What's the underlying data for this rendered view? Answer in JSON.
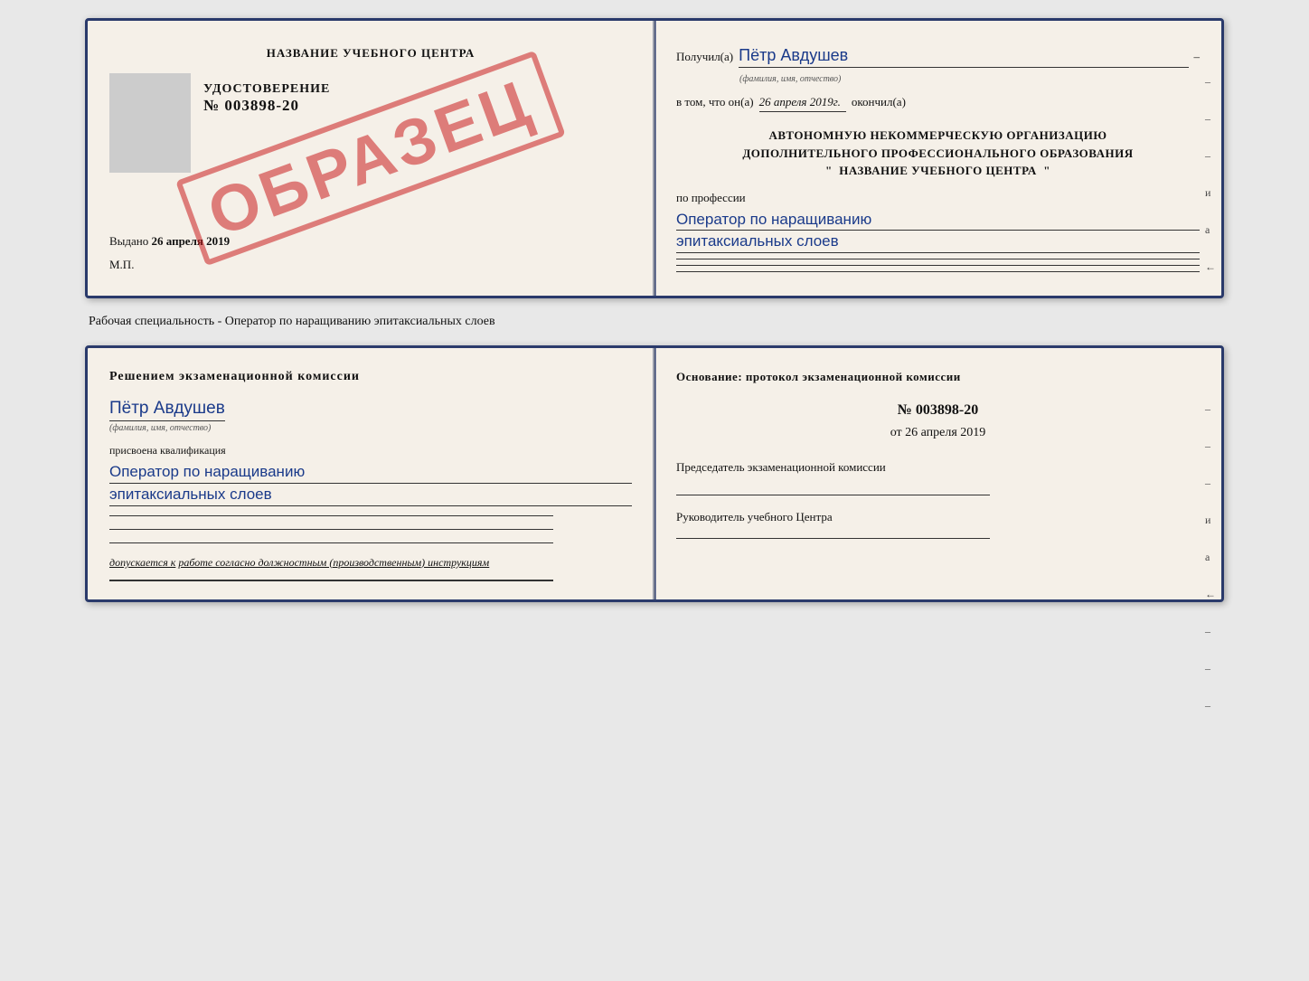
{
  "top_card": {
    "left": {
      "title": "НАЗВАНИЕ УЧЕБНОГО ЦЕНТРА",
      "udostoverenie_label": "УДОСТОВЕРЕНИЕ",
      "number": "№ 003898-20",
      "vydano_prefix": "Выдано",
      "vydano_date": "26 апреля 2019",
      "mp_label": "М.П.",
      "stamp_text": "ОБРАЗЕЦ"
    },
    "right": {
      "poluchil_prefix": "Получил(а)",
      "recipient_name": "Пётр Авдушев",
      "fio_hint": "(фамилия, имя, отчество)",
      "dash": "–",
      "vtom_prefix": "в том, что он(а)",
      "vtom_date": "26 апреля 2019г.",
      "okoncil": "окончил(а)",
      "org_line1": "АВТОНОМНУЮ НЕКОММЕРЧЕСКУЮ ОРГАНИЗАЦИЮ",
      "org_line2": "ДОПОЛНИТЕЛЬНОГО ПРОФЕССИОНАЛЬНОГО ОБРАЗОВАНИЯ",
      "org_quote1": "\"",
      "org_name": "НАЗВАНИЕ УЧЕБНОГО ЦЕНТРА",
      "org_quote2": "\"",
      "po_professii": "по профессии",
      "profession": "Оператор по наращиванию",
      "profession2": "эпитаксиальных слоев",
      "right_marks": [
        "–",
        "–",
        "–",
        "и",
        "а",
        "←"
      ]
    }
  },
  "specialty_text": "Рабочая специальность - Оператор по наращиванию эпитаксиальных слоев",
  "bottom_card": {
    "left": {
      "resheniem": "Решением  экзаменационной  комиссии",
      "name": "Пётр Авдушев",
      "fio_hint": "(фамилия, имя, отчество)",
      "prisvoena": "присвоена квалификация",
      "qualification": "Оператор по наращиванию",
      "qualification2": "эпитаксиальных слоев",
      "dopuskaetsya_prefix": "допускается к",
      "dopuskaetsya_text": "работе согласно должностным (производственным) инструкциям"
    },
    "right": {
      "osnovanie": "Основание: протокол экзаменационной  комиссии",
      "number": "№  003898-20",
      "ot_prefix": "от",
      "ot_date": "26 апреля 2019",
      "predsedatel": "Председатель экзаменационной комиссии",
      "rukovoditel": "Руководитель учебного Центра",
      "right_marks": [
        "–",
        "–",
        "–",
        "и",
        "а",
        "←",
        "–",
        "–",
        "–"
      ]
    }
  }
}
